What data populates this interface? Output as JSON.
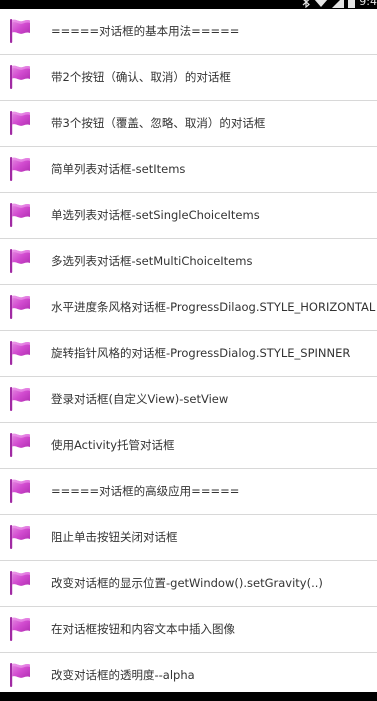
{
  "status_bar": {
    "time": "9:4"
  },
  "list": {
    "items": [
      {
        "label": "=====对话框的基本用法====="
      },
      {
        "label": "带2个按钮（确认、取消）的对话框"
      },
      {
        "label": "带3个按钮（覆盖、忽略、取消）的对话框"
      },
      {
        "label": "简单列表对话框-setItems"
      },
      {
        "label": "单选列表对话框-setSingleChoiceItems"
      },
      {
        "label": "多选列表对话框-setMultiChoiceItems"
      },
      {
        "label": "水平进度条风格对话框-ProgressDilaog.STYLE_HORIZONTAL"
      },
      {
        "label": "旋转指针风格的对话框-ProgressDialog.STYLE_SPINNER"
      },
      {
        "label": "登录对话框(自定义View)-setView"
      },
      {
        "label": "使用Activity托管对话框"
      },
      {
        "label": "=====对话框的高级应用====="
      },
      {
        "label": "阻止单击按钮关闭对话框"
      },
      {
        "label": "改变对话框的显示位置-getWindow().setGravity(..)"
      },
      {
        "label": "在对话框按钮和内容文本中插入图像"
      },
      {
        "label": "改变对话框的透明度--alpha"
      }
    ],
    "icon": "flag-icon",
    "icon_color": "#d64fd0"
  },
  "colors": {
    "background": "#ffffff",
    "text": "#333333",
    "divider": "#d8d8d8",
    "status_bar": "#000000"
  }
}
